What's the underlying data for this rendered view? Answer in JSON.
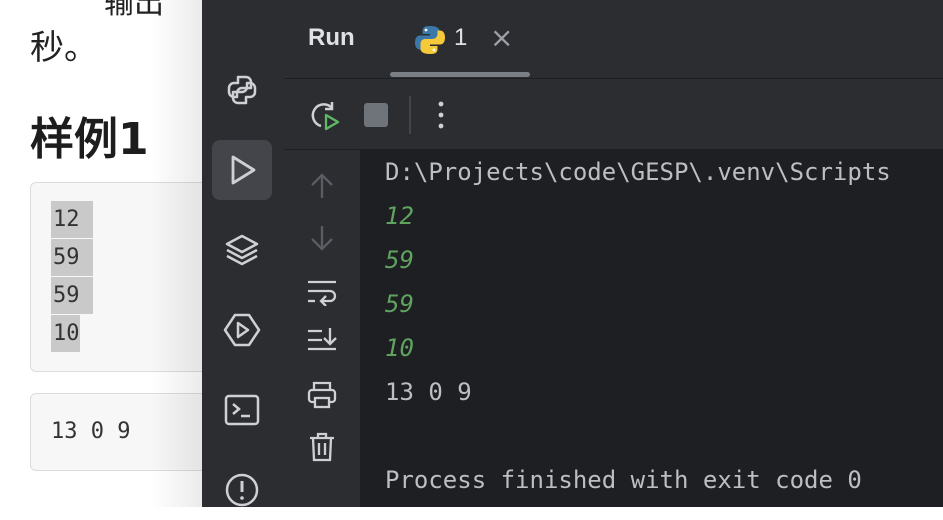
{
  "document": {
    "top_fragment": "输出",
    "second_line": "秒。",
    "heading": "样例1",
    "input_lines": [
      "12",
      "59",
      "59",
      "10"
    ],
    "output_line": "13 0 9"
  },
  "sidebar": {
    "items": [
      {
        "icon": "python-console-icon"
      },
      {
        "icon": "run-icon",
        "active": true
      },
      {
        "icon": "layers-icon"
      },
      {
        "icon": "services-icon"
      },
      {
        "icon": "terminal-icon"
      },
      {
        "icon": "problems-icon"
      }
    ]
  },
  "run_window": {
    "title": "Run",
    "tab": {
      "label": "1",
      "icon": "python-icon",
      "close": "×"
    },
    "toolbar": [
      "rerun-icon",
      "stop-icon",
      "more-icon"
    ],
    "gutter": [
      "up-arrow-icon",
      "down-arrow-icon",
      "soft-wrap-icon",
      "scroll-to-end-icon",
      "print-icon",
      "trash-icon"
    ],
    "console": {
      "command": "D:\\Projects\\code\\GESP\\.venv\\Scripts",
      "inputs": [
        "12",
        "59",
        "59",
        "10"
      ],
      "output": "13 0 9",
      "exit_message": "Process finished with exit code 0"
    }
  },
  "colors": {
    "panel": "#2b2d30",
    "console_bg": "#1e1f22",
    "input_text": "#5fa35f",
    "text": "#bcbec4"
  }
}
